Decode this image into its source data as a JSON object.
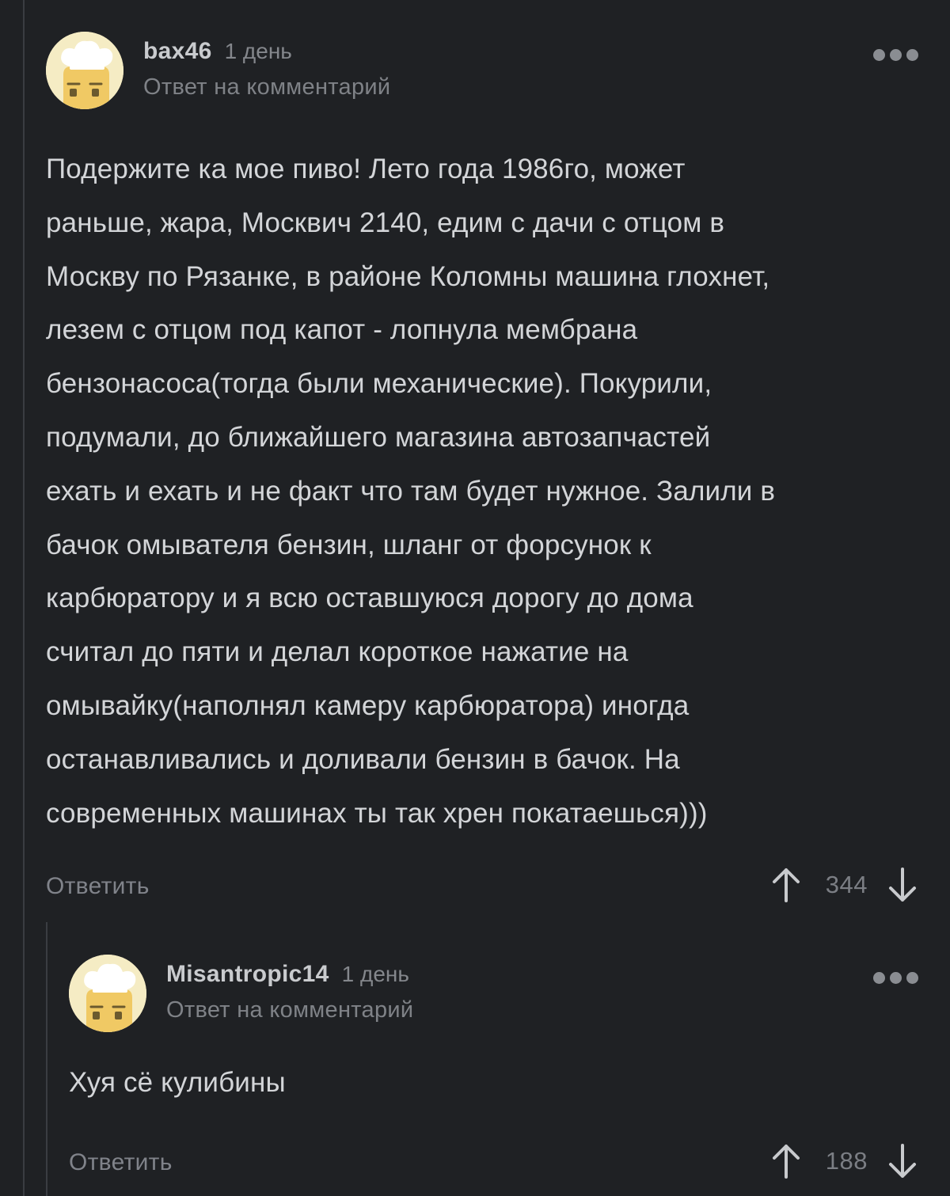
{
  "comments": [
    {
      "username": "bax46",
      "time": "1 день",
      "reply_note": "Ответ на комментарий",
      "text": "Подержите ка мое пиво! Лето года 1986го, может\nраньше, жара, Москвич 2140, едим с дачи с отцом в\nМоскву по Рязанке, в районе Коломны машина глохнет,\nлезем с отцом под капот - лопнула мембрана\nбензонасоса(тогда были механические). Покурили,\nподумали, до ближайшего магазина автозапчастей\nехать и ехать и не факт что там будет нужное. Залили в\nбачок омывателя бензин, шланг от форсунок к\nкарбюратору и я всю оставшуюся дорогу до дома\nсчитал до пяти и делал короткое нажатие на\nомывайку(наполнял камеру карбюратора) иногда\nостанавливались и доливали бензин в бачок. На\nсовременных машинах ты так хрен покатаешься)))",
      "reply_label": "Ответить",
      "score": "344"
    },
    {
      "username": "Misantropic14",
      "time": "1 день",
      "reply_note": "Ответ на комментарий",
      "text": "Хуя сё кулибины",
      "reply_label": "Ответить",
      "score": "188"
    }
  ],
  "icons": {
    "more": "more-dots-icon",
    "upvote": "arrow-up-icon",
    "downvote": "arrow-down-icon",
    "avatar": "default-avatar-chef-icon"
  },
  "colors": {
    "background": "#1f2124",
    "text": "#d3d5d8",
    "muted": "#7f8287",
    "avatar_bg": "#f5ecc4",
    "avatar_face": "#f0c964"
  }
}
